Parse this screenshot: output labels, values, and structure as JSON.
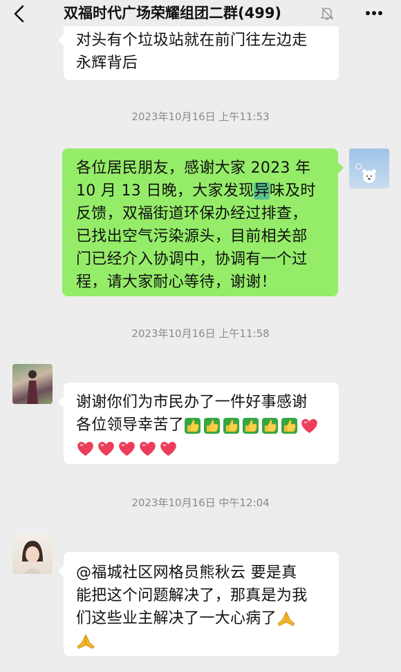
{
  "header": {
    "title": "双福时代广场荣耀组团二群(499)",
    "back_icon": "back-arrow-icon",
    "mute_icon": "bell-muted-icon",
    "more_icon": "more-dots-icon"
  },
  "messages": [
    {
      "id": "msg1",
      "side": "left",
      "lines": [
        "对头有个垃圾站就在前门往左边走",
        "永辉背后"
      ]
    },
    {
      "id": "ts1",
      "type": "timestamp",
      "text": "2023年10月16日 上午11:53"
    },
    {
      "id": "msg2",
      "side": "right",
      "lines": [
        "各位居民朋友，感谢大家 2023 年",
        "10 月 13 日晚，大家发现",
        "异",
        "味及时",
        "反馈，双福街道环保办经过排查，",
        "已找出空气污染源头，目前相关部",
        "门已经介入协调中，协调有一个过",
        "程，请大家耐心等待，谢谢！"
      ]
    },
    {
      "id": "ts2",
      "type": "timestamp",
      "text": "2023年10月16日 上午11:58"
    },
    {
      "id": "msg3",
      "side": "left",
      "lines": [
        "谢谢你们为市民办了一件好事感谢",
        "各位领导幸苦了"
      ],
      "emoji_line1": [
        "thumbs-up",
        "thumbs-up",
        "thumbs-up",
        "thumbs-up",
        "thumbs-up",
        "thumbs-up",
        "heart"
      ],
      "emoji_line2": [
        "heart",
        "heart",
        "heart",
        "heart",
        "heart"
      ]
    },
    {
      "id": "ts3",
      "type": "timestamp",
      "text": "2023年10月16日 中午12:04"
    },
    {
      "id": "msg4",
      "side": "left",
      "lines": [
        "@福城社区网格员熊秋云  要是真",
        "能把这个问题解决了，那真是为我",
        "们这些业主解决了一大心病了"
      ],
      "emoji_after": [
        "pray",
        "pray"
      ]
    }
  ],
  "colors": {
    "background": "#ededed",
    "bubble_self": "#95ec69",
    "bubble_other": "#ffffff",
    "timestamp": "#8a8a8a",
    "highlight": "#58c08f"
  }
}
